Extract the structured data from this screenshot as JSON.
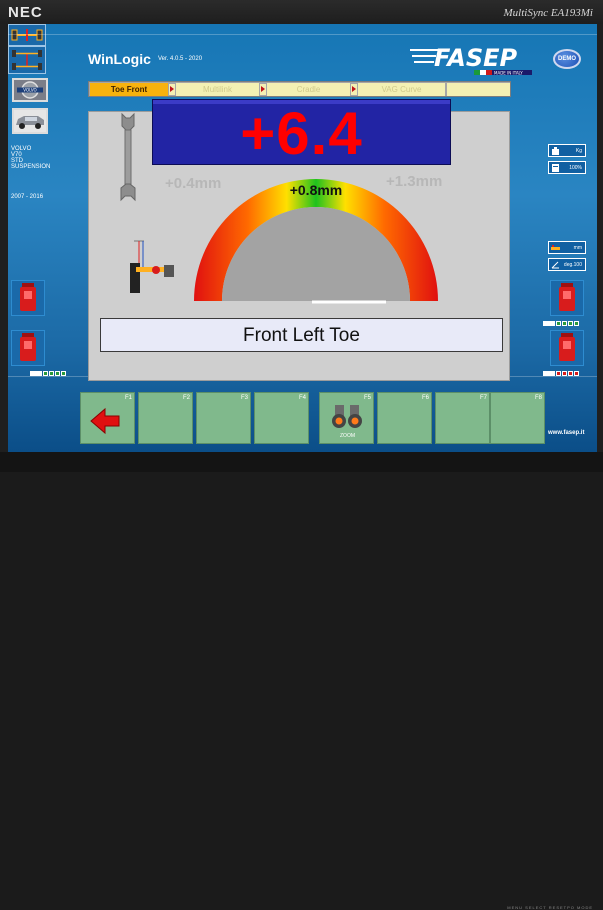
{
  "monitor": {
    "brand": "NEC",
    "model": "MultiSync EA193Mi",
    "buttons": "MENU   SELECT  RESETPO MODE"
  },
  "app": {
    "title": "WinLogic",
    "version": "Ver. 4.0.5 - 2020",
    "logo_text": "FASEP",
    "logo_tagline": "MADE IN ITALY",
    "demo_label": "DEMO"
  },
  "tabs": [
    {
      "label": "Toe Front",
      "active": true
    },
    {
      "label": "Multilink",
      "active": false
    },
    {
      "label": "Cradle",
      "active": false
    },
    {
      "label": "VAG Curve",
      "active": false
    }
  ],
  "vehicle": {
    "brand_logo": "VOLVO",
    "lines": [
      "VOLVO",
      "V70",
      "STD",
      "SUSPENSION"
    ],
    "years": "2007 - 2016"
  },
  "info": {
    "unit_kg": "Kg",
    "percent": "100%",
    "unit_mm": "mm",
    "unit_deg": "deg.100"
  },
  "measurement": {
    "value": "+6.4",
    "tolerance_min": "+0.4mm",
    "tolerance_nominal": "+0.8mm",
    "tolerance_max": "+1.3mm",
    "label": "Front Left Toe"
  },
  "fkeys": [
    {
      "label": "F1",
      "icon": "back-arrow-icon"
    },
    {
      "label": "F2"
    },
    {
      "label": "F3"
    },
    {
      "label": "F4"
    },
    {
      "label": "F5",
      "icon": "binoculars-icon",
      "caption": "ZOOM"
    },
    {
      "label": "F6"
    },
    {
      "label": "F7"
    },
    {
      "label": "F8"
    }
  ],
  "footer": {
    "url": "www.fasep.it"
  },
  "colors": {
    "screen_bg": "#2a85c2",
    "accent_tab": "#f7b20e",
    "value_bg": "#2224a4",
    "value_text": "#ff0000",
    "fkey_bg": "#80b98c"
  }
}
